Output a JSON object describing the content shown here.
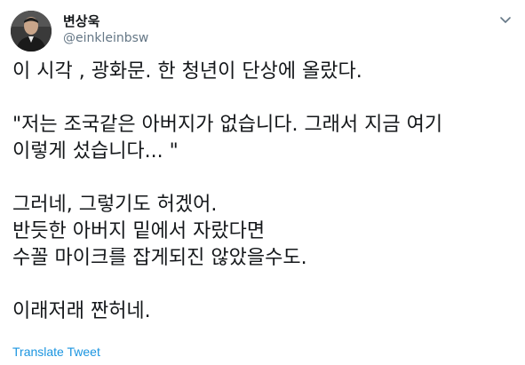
{
  "author": {
    "name": "변상욱",
    "handle": "@einkleinbsw"
  },
  "icons": {
    "avatar": "profile-photo",
    "menu": "chevron-down-icon"
  },
  "tweet": {
    "lines": [
      "이 시각 , 광화문. 한 청년이 단상에 올랐다.",
      "\"저는 조국같은 아버지가 없습니다. 그래서 지금 여기",
      "이렇게 섰습니다... \"",
      "그러네, 그렇기도 허겠어.",
      "반듯한 아버지 밑에서 자랐다면",
      "수꼴 마이크를 잡게되진 않았을수도.",
      "이래저래 짠허네."
    ]
  },
  "translate_label": "Translate Tweet",
  "colors": {
    "text": "#14171a",
    "muted": "#657786",
    "link": "#1b95e0"
  }
}
